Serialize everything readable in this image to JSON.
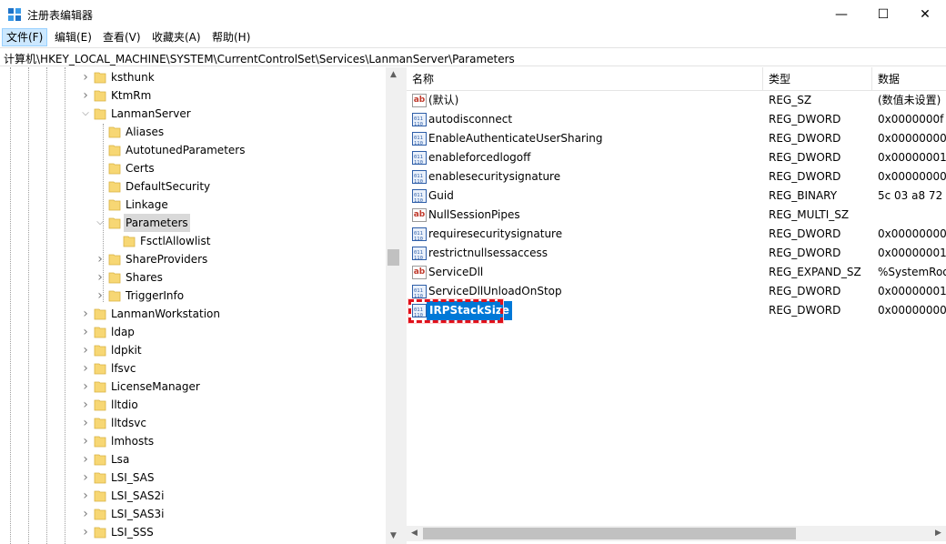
{
  "window": {
    "title": "注册表编辑器",
    "minimize_glyph": "—",
    "maximize_glyph": "☐",
    "close_glyph": "✕"
  },
  "menu": {
    "items": [
      {
        "label": "文件(F)"
      },
      {
        "label": "编辑(E)"
      },
      {
        "label": "查看(V)"
      },
      {
        "label": "收藏夹(A)"
      },
      {
        "label": "帮助(H)"
      }
    ]
  },
  "address": {
    "path": "计算机\\HKEY_LOCAL_MACHINE\\SYSTEM\\CurrentControlSet\\Services\\LanmanServer\\Parameters"
  },
  "tree": {
    "items": [
      {
        "label": "ksthunk",
        "level": 0,
        "expander": "collapsed"
      },
      {
        "label": "KtmRm",
        "level": 0,
        "expander": "collapsed"
      },
      {
        "label": "LanmanServer",
        "level": 0,
        "expander": "expanded"
      },
      {
        "label": "Aliases",
        "level": 1,
        "expander": "none"
      },
      {
        "label": "AutotunedParameters",
        "level": 1,
        "expander": "none"
      },
      {
        "label": "Certs",
        "level": 1,
        "expander": "none"
      },
      {
        "label": "DefaultSecurity",
        "level": 1,
        "expander": "none"
      },
      {
        "label": "Linkage",
        "level": 1,
        "expander": "none"
      },
      {
        "label": "Parameters",
        "level": 1,
        "expander": "expanded",
        "selected": true
      },
      {
        "label": "FsctlAllowlist",
        "level": 2,
        "expander": "none"
      },
      {
        "label": "ShareProviders",
        "level": 1,
        "expander": "collapsed"
      },
      {
        "label": "Shares",
        "level": 1,
        "expander": "collapsed"
      },
      {
        "label": "TriggerInfo",
        "level": 1,
        "expander": "collapsed"
      },
      {
        "label": "LanmanWorkstation",
        "level": 0,
        "expander": "collapsed"
      },
      {
        "label": "ldap",
        "level": 0,
        "expander": "collapsed"
      },
      {
        "label": "ldpkit",
        "level": 0,
        "expander": "collapsed"
      },
      {
        "label": "lfsvc",
        "level": 0,
        "expander": "collapsed"
      },
      {
        "label": "LicenseManager",
        "level": 0,
        "expander": "collapsed"
      },
      {
        "label": "lltdio",
        "level": 0,
        "expander": "collapsed"
      },
      {
        "label": "lltdsvc",
        "level": 0,
        "expander": "collapsed"
      },
      {
        "label": "lmhosts",
        "level": 0,
        "expander": "collapsed"
      },
      {
        "label": "Lsa",
        "level": 0,
        "expander": "collapsed"
      },
      {
        "label": "LSI_SAS",
        "level": 0,
        "expander": "collapsed"
      },
      {
        "label": "LSI_SAS2i",
        "level": 0,
        "expander": "collapsed"
      },
      {
        "label": "LSI_SAS3i",
        "level": 0,
        "expander": "collapsed"
      },
      {
        "label": "LSI_SSS",
        "level": 0,
        "expander": "collapsed"
      }
    ]
  },
  "list": {
    "columns": [
      "名称",
      "类型",
      "数据"
    ],
    "rows": [
      {
        "icon": "string-value-icon",
        "name": "(默认)",
        "type": "REG_SZ",
        "data": "(数值未设置)"
      },
      {
        "icon": "binary-value-icon",
        "name": "autodisconnect",
        "type": "REG_DWORD",
        "data": "0x0000000f ("
      },
      {
        "icon": "binary-value-icon",
        "name": "EnableAuthenticateUserSharing",
        "type": "REG_DWORD",
        "data": "0x00000000"
      },
      {
        "icon": "binary-value-icon",
        "name": "enableforcedlogoff",
        "type": "REG_DWORD",
        "data": "0x00000001"
      },
      {
        "icon": "binary-value-icon",
        "name": "enablesecuritysignature",
        "type": "REG_DWORD",
        "data": "0x00000000"
      },
      {
        "icon": "binary-value-icon",
        "name": "Guid",
        "type": "REG_BINARY",
        "data": "5c 03 a8 72"
      },
      {
        "icon": "string-value-icon",
        "name": "NullSessionPipes",
        "type": "REG_MULTI_SZ",
        "data": ""
      },
      {
        "icon": "binary-value-icon",
        "name": "requiresecuritysignature",
        "type": "REG_DWORD",
        "data": "0x00000000"
      },
      {
        "icon": "binary-value-icon",
        "name": "restrictnullsessaccess",
        "type": "REG_DWORD",
        "data": "0x00000001"
      },
      {
        "icon": "string-value-icon",
        "name": "ServiceDll",
        "type": "REG_EXPAND_SZ",
        "data": "%SystemRoo"
      },
      {
        "icon": "binary-value-icon",
        "name": "ServiceDllUnloadOnStop",
        "type": "REG_DWORD",
        "data": "0x00000001"
      },
      {
        "icon": "binary-value-icon",
        "name": "IRPStackSize",
        "type": "REG_DWORD",
        "data": "0x00000000",
        "selected": true
      }
    ]
  },
  "colors": {
    "selection": "#0078d7",
    "highlight_box": "#e0101a",
    "folder": "#f7d774"
  }
}
